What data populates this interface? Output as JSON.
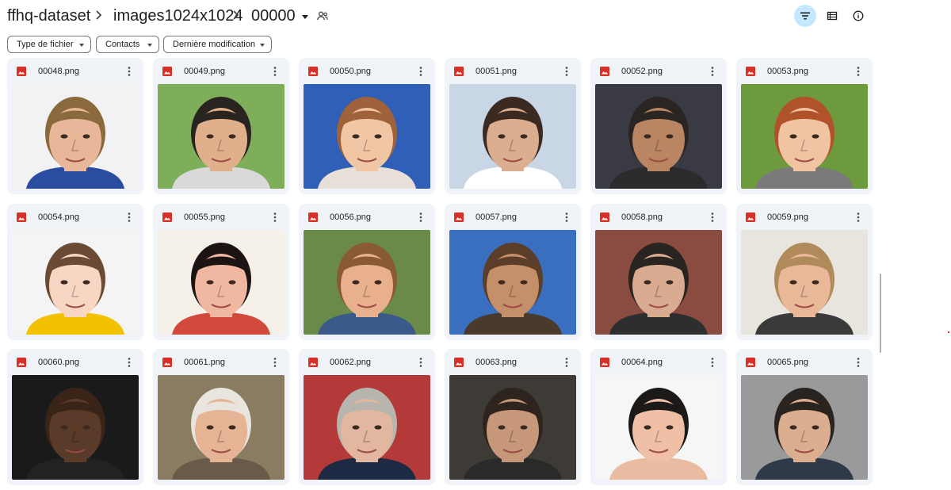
{
  "breadcrumb": {
    "items": [
      "ffhq-dataset",
      "images1024x1024",
      "00000"
    ]
  },
  "toolbar": {
    "filter_icon": "filter-icon",
    "view_icon": "list-view-icon",
    "info_icon": "info-icon"
  },
  "filters": {
    "type": "Type de fichier",
    "people": "Contacts",
    "modified": "Dernière modification"
  },
  "colors": {
    "accent": "#c2e7ff",
    "card_bg": "#f0f4f9",
    "file_icon_red": "#d93025"
  },
  "files": [
    {
      "name": "00048.png",
      "skin": "#e8b79a",
      "hair": "#8a6a3c",
      "bg": "#f2f2f2",
      "shirt": "#2a4da0"
    },
    {
      "name": "00049.png",
      "skin": "#e0b08c",
      "hair": "#2a2420",
      "bg": "#7fae5a",
      "shirt": "#d9d9d9"
    },
    {
      "name": "00050.png",
      "skin": "#f0c6a4",
      "hair": "#a0623a",
      "bg": "#2f5fb6",
      "shirt": "#e8e0d8"
    },
    {
      "name": "00051.png",
      "skin": "#dcae90",
      "hair": "#3a2a22",
      "bg": "#c9d6e6",
      "shirt": "#ffffff"
    },
    {
      "name": "00052.png",
      "skin": "#b98563",
      "hair": "#2a2522",
      "bg": "#3a3a44",
      "shirt": "#2b2b2b"
    },
    {
      "name": "00053.png",
      "skin": "#f0c3a2",
      "hair": "#b0532a",
      "bg": "#6d9a3c",
      "shirt": "#7a7a7a"
    },
    {
      "name": "00054.png",
      "skin": "#f7d6c3",
      "hair": "#6a4a34",
      "bg": "#f4f4f4",
      "shirt": "#f2c200"
    },
    {
      "name": "00055.png",
      "skin": "#f0b8a0",
      "hair": "#1c1412",
      "bg": "#f5f0e8",
      "shirt": "#d24a3c"
    },
    {
      "name": "00056.png",
      "skin": "#e9b08e",
      "hair": "#8a5a32",
      "bg": "#6a8a4a",
      "shirt": "#3a5a8a"
    },
    {
      "name": "00057.png",
      "skin": "#c58f6a",
      "hair": "#5a3e2a",
      "bg": "#3a6fc0",
      "shirt": "#4a3a2c"
    },
    {
      "name": "00058.png",
      "skin": "#d9ac92",
      "hair": "#2a2420",
      "bg": "#8a4c40",
      "shirt": "#2e2e2e"
    },
    {
      "name": "00059.png",
      "skin": "#e8b898",
      "hair": "#b08a5a",
      "bg": "#e8e4de",
      "shirt": "#3a3a3a"
    },
    {
      "name": "00060.png",
      "skin": "#5a3a28",
      "hair": "#3a2418",
      "bg": "#1a1a1a",
      "shirt": "#222222"
    },
    {
      "name": "00061.png",
      "skin": "#e6b494",
      "hair": "#e8e4de",
      "bg": "#8a7c60",
      "shirt": "#6a5a4a"
    },
    {
      "name": "00062.png",
      "skin": "#e2b7a0",
      "hair": "#b8b4ae",
      "bg": "#b43a3a",
      "shirt": "#1e2a44"
    },
    {
      "name": "00063.png",
      "skin": "#c7977a",
      "hair": "#2e241e",
      "bg": "#3e3a36",
      "shirt": "#2a2a2a"
    },
    {
      "name": "00064.png",
      "skin": "#efc0a6",
      "hair": "#1c1a18",
      "bg": "#f6f6f6",
      "shirt": "#e9bba0"
    },
    {
      "name": "00065.png",
      "skin": "#dcae90",
      "hair": "#2a2420",
      "bg": "#9a9a9a",
      "shirt": "#2e3a4a"
    }
  ]
}
